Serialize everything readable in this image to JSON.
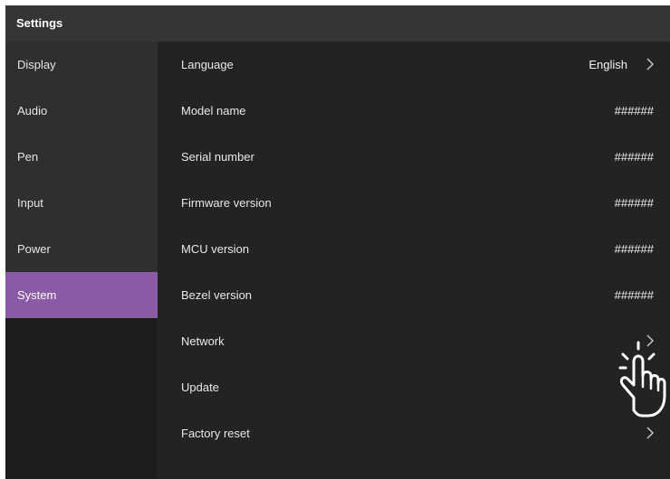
{
  "window": {
    "title": "Settings"
  },
  "sidebar": {
    "items": [
      {
        "label": "Display"
      },
      {
        "label": "Audio"
      },
      {
        "label": "Pen"
      },
      {
        "label": "Input"
      },
      {
        "label": "Power"
      },
      {
        "label": "System",
        "active": true
      }
    ]
  },
  "system": {
    "rows": [
      {
        "label": "Language",
        "value": "English",
        "chevron": true
      },
      {
        "label": "Model name",
        "value": "######"
      },
      {
        "label": "Serial number",
        "value": "######"
      },
      {
        "label": "Firmware version",
        "value": "######"
      },
      {
        "label": "MCU version",
        "value": "######"
      },
      {
        "label": "Bezel version",
        "value": "######"
      },
      {
        "label": "Network",
        "chevron": true
      },
      {
        "label": "Update",
        "chevron": true
      },
      {
        "label": "Factory reset",
        "chevron": true
      }
    ]
  },
  "colors": {
    "accent": "#8b5aa6",
    "background": "#232323",
    "titlebar": "#353535",
    "sidebar_item": "#2f2f2f"
  },
  "icons": {
    "chevron": "chevron-right-icon",
    "pointer": "hand-pointer-icon"
  }
}
